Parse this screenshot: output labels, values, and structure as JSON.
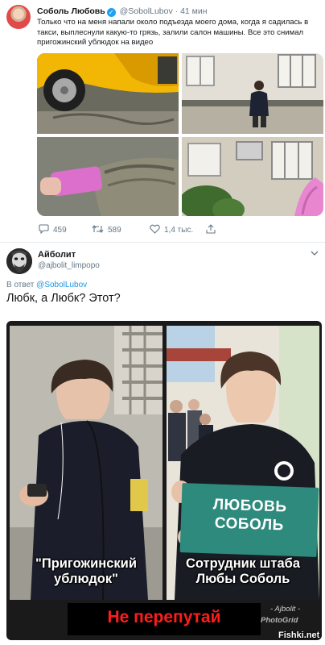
{
  "tweet": {
    "author_name": "Соболь Любовь",
    "author_handle": "@SobolLubov",
    "time": "· 41 мин",
    "text": "Только что на меня напали около подъезда моего дома, когда я садилась в такси, выплеснули какую-то грязь, залили салон машины. Все это снимал пригожинский ублюдок на видео",
    "stats": {
      "replies": "459",
      "retweets": "589",
      "likes": "1,4 тыс."
    },
    "icons": [
      "reply-icon",
      "retweet-icon",
      "like-icon",
      "share-icon"
    ]
  },
  "reply": {
    "author_name": "Айболит",
    "author_handle": "@ajbolit_limpopo",
    "reply_prefix": "В ответ",
    "reply_to": "@SobolLubov",
    "text": "Любк, а Любк? Этот?"
  },
  "meme": {
    "left_caption": "\"Пригожинский ублюдок\"",
    "right_caption": "Сотрудник штаба Любы Соболь",
    "sign_text": "ЛЮБОВЬ СОБОЛЬ",
    "banner": "Не перепутай",
    "signature": "- Ajbolit -",
    "signature_app": "PhotoGrid"
  },
  "watermark": "Fishki.net",
  "colors": {
    "link": "#1b95e0",
    "muted": "#657786",
    "verified": "#1da1f2",
    "banner_text": "#ff1c1c",
    "sign": "#2e8a7c"
  }
}
